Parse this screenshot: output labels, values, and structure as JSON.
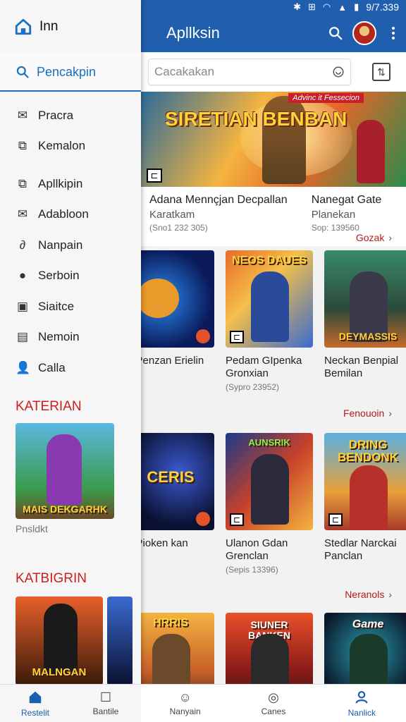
{
  "status": {
    "time": "9/7.339"
  },
  "appbar": {
    "title": "Apllksin"
  },
  "search": {
    "placeholder": "Cacakakan"
  },
  "drawer": {
    "header": "Inn",
    "search_label": "Pencakpin",
    "items": [
      {
        "label": "Pracra",
        "icon": "mail-icon"
      },
      {
        "label": "Kemalon",
        "icon": "contact-icon"
      },
      {
        "label": "Apllkipin",
        "icon": "app-icon"
      },
      {
        "label": "Adabloon",
        "icon": "mail-icon"
      },
      {
        "label": "Nanpain",
        "icon": "link-icon"
      },
      {
        "label": "Serboin",
        "icon": "location-icon"
      },
      {
        "label": "Siaitce",
        "icon": "calendar-icon"
      },
      {
        "label": "Nemoin",
        "icon": "list-icon"
      },
      {
        "label": "Calla",
        "icon": "person-icon"
      }
    ],
    "section1": "KATERIAN",
    "section1_thumb_title": "MAIS DEKGARHK",
    "section1_caption": "Pnsldkt",
    "section2": "KATBIGRIN",
    "section2_thumb_title": "MALNGAN"
  },
  "banner": {
    "title": "SIRETIAN BENBAN",
    "badge": "Advinc it Fessecion",
    "left": {
      "name": "Adana Mennçjan Decpallan",
      "sub": "Karatkam",
      "meta": "(Sno1 232 305)"
    },
    "right": {
      "name": "Nanegat Gate",
      "sub": "Planekan",
      "meta": "Sop: 139560"
    },
    "link": "Gozak"
  },
  "row1": {
    "games": [
      {
        "title": "",
        "name": "n Penzan Erielin",
        "meta": ""
      },
      {
        "title": "NEOS DAUES",
        "name": "Pedam GIpenka Gronxian",
        "meta": "(Sypro 23952)"
      },
      {
        "title": "DEYMASSIS",
        "name": "Neckan Benpial Bemilan",
        "meta": ""
      }
    ],
    "link": "Fenouoin"
  },
  "row2": {
    "games": [
      {
        "title": "CERIS",
        "name": "n Pioken kan",
        "meta": ""
      },
      {
        "title": "AUNSRIK",
        "name": "Ulanon Gdan Grenclan",
        "meta": "(Sepis 13396)"
      },
      {
        "title": "DRING BENDONK",
        "name": "Stedlar Narckai Panclan",
        "meta": ""
      }
    ],
    "link": "Neranols"
  },
  "row3": {
    "games": [
      {
        "title": "HRRIS"
      },
      {
        "title": "SIUNER BANKEN"
      },
      {
        "title": "Game"
      }
    ]
  },
  "bottom_nav": [
    {
      "label": "Restelit",
      "icon": "home-icon",
      "active": true
    },
    {
      "label": "Bantile",
      "icon": "square-icon",
      "active": false
    },
    {
      "label": "Nanyain",
      "icon": "people-icon",
      "active": false
    },
    {
      "label": "Canes",
      "icon": "game-icon",
      "active": false
    },
    {
      "label": "Nanlick",
      "icon": "person-icon",
      "active": true
    }
  ],
  "colors": {
    "primary": "#1f5fae",
    "accent_red": "#c82020",
    "link": "#1a6fc4"
  }
}
